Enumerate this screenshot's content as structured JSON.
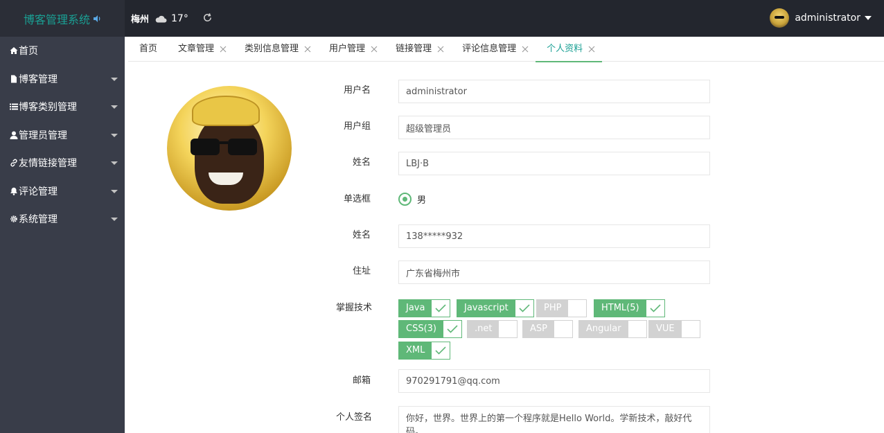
{
  "header": {
    "logo": "博客管理系统",
    "city": "梅州",
    "temperature": "17°",
    "username": "administrator"
  },
  "sidebar": {
    "items": [
      {
        "label": "首页",
        "icon": "home-icon",
        "has_caret": false
      },
      {
        "label": "博客管理",
        "icon": "file-icon",
        "has_caret": true
      },
      {
        "label": "博客类别管理",
        "icon": "list-icon",
        "has_caret": true
      },
      {
        "label": "管理员管理",
        "icon": "user-icon",
        "has_caret": true
      },
      {
        "label": "友情链接管理",
        "icon": "link-icon",
        "has_caret": true
      },
      {
        "label": "评论管理",
        "icon": "bell-icon",
        "has_caret": true
      },
      {
        "label": "系统管理",
        "icon": "gear-icon",
        "has_caret": true
      }
    ]
  },
  "tabs": [
    {
      "label": "首页",
      "closable": false,
      "active": false
    },
    {
      "label": "文章管理",
      "closable": true,
      "active": false
    },
    {
      "label": "类别信息管理",
      "closable": true,
      "active": false
    },
    {
      "label": "用户管理",
      "closable": true,
      "active": false
    },
    {
      "label": "链接管理",
      "closable": true,
      "active": false
    },
    {
      "label": "评论信息管理",
      "closable": true,
      "active": false
    },
    {
      "label": "个人资料",
      "closable": true,
      "active": true
    }
  ],
  "form": {
    "username": {
      "label": "用户名",
      "value": "administrator"
    },
    "group": {
      "label": "用户组",
      "value": "超级管理员"
    },
    "realname": {
      "label": "姓名",
      "value": "LBJ·B"
    },
    "radio": {
      "label": "单选框",
      "option": "男",
      "checked": true
    },
    "phone": {
      "label": "姓名",
      "value": "138*****932"
    },
    "address": {
      "label": "住址",
      "value": "广东省梅州市"
    },
    "skills_label": "掌握技术",
    "skills": [
      {
        "label": "Java",
        "checked": true
      },
      {
        "label": "Javascript",
        "checked": true
      },
      {
        "label": "PHP",
        "checked": false
      },
      {
        "label": "HTML(5)",
        "checked": true
      },
      {
        "label": "CSS(3)",
        "checked": true
      },
      {
        "label": ".net",
        "checked": false
      },
      {
        "label": "ASP",
        "checked": false
      },
      {
        "label": "Angular",
        "checked": false
      },
      {
        "label": "VUE",
        "checked": false
      },
      {
        "label": "XML",
        "checked": true
      }
    ],
    "email": {
      "label": "邮箱",
      "value": "970291791@qq.com"
    },
    "signature": {
      "label": "个人签名",
      "value": "你好，世界。世界上的第一个程序就是Hello World。学新技术，敲好代码。"
    }
  },
  "colors": {
    "accent": "#5fb878",
    "brand": "#1aa094",
    "sidebar": "#393d49",
    "header": "#23262e"
  }
}
